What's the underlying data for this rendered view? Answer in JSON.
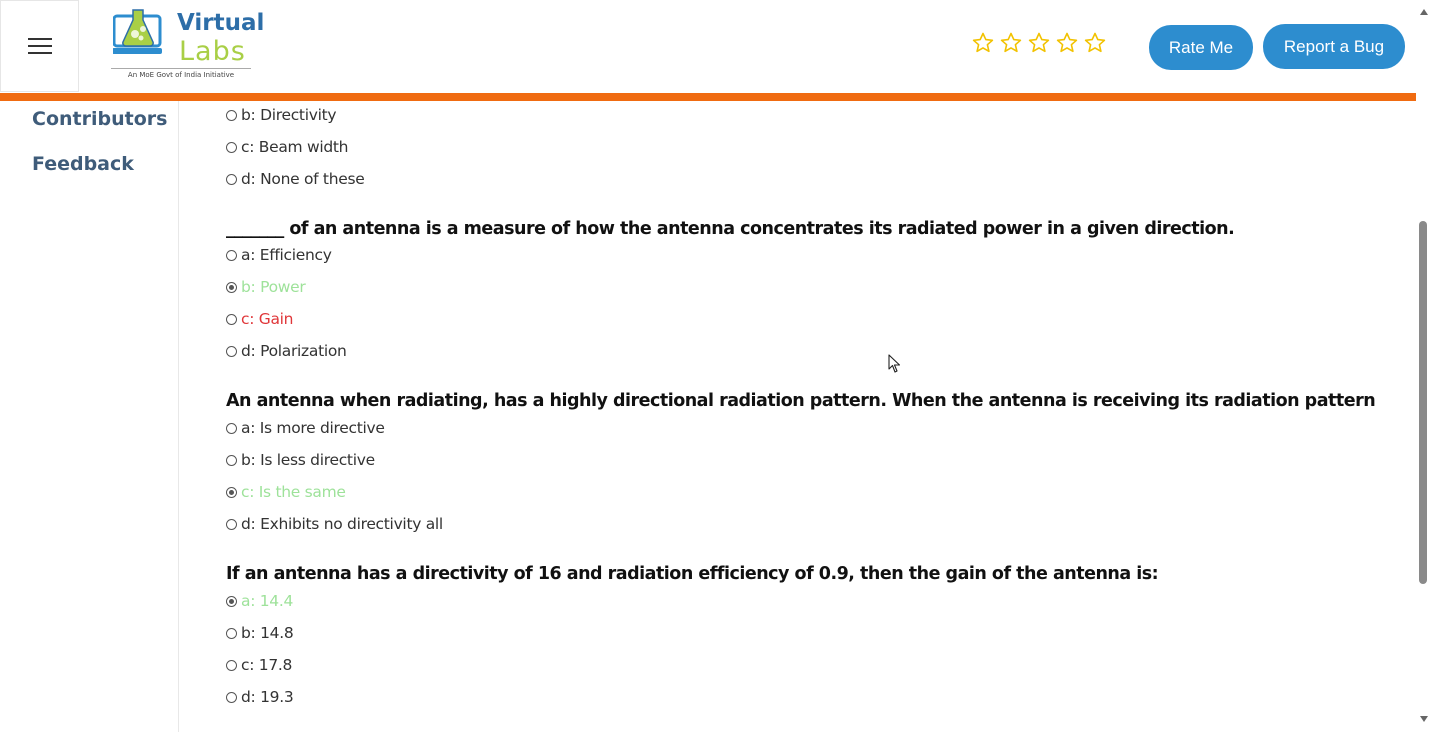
{
  "header": {
    "logo": {
      "word1": "Virtual",
      "word2": "Labs",
      "tagline": "An MoE Govt of India Initiative"
    },
    "rating": {
      "stars_total": 5,
      "stars_filled": 0
    },
    "rate_button_label": "Rate Me",
    "report_button_label": "Report a Bug"
  },
  "sidebar": {
    "items": [
      {
        "label": "Contributors"
      },
      {
        "label": "Feedback"
      }
    ]
  },
  "quiz": {
    "top_options": [
      {
        "label": "b: Directivity",
        "checked": false,
        "state": "normal"
      },
      {
        "label": "c: Beam width",
        "checked": false,
        "state": "normal"
      },
      {
        "label": "d: None of these",
        "checked": false,
        "state": "normal"
      }
    ],
    "questions": [
      {
        "text": "_______ of an antenna is a measure of how the antenna concentrates its radiated power in a given direction.",
        "options": [
          {
            "label": "a: Efficiency",
            "checked": false,
            "state": "normal"
          },
          {
            "label": "b: Power",
            "checked": true,
            "state": "correct"
          },
          {
            "label": "c: Gain",
            "checked": false,
            "state": "wrong"
          },
          {
            "label": "d: Polarization",
            "checked": false,
            "state": "normal"
          }
        ]
      },
      {
        "text": "An antenna when radiating, has a highly directional radiation pattern. When the antenna is receiving its radiation pattern",
        "options": [
          {
            "label": "a: Is more directive",
            "checked": false,
            "state": "normal"
          },
          {
            "label": "b: Is less directive",
            "checked": false,
            "state": "normal"
          },
          {
            "label": "c: Is the same",
            "checked": true,
            "state": "correct"
          },
          {
            "label": "d: Exhibits no directivity all",
            "checked": false,
            "state": "normal"
          }
        ]
      },
      {
        "text": "If an antenna has a directivity of 16 and radiation efficiency of 0.9, then the gain of the antenna is:",
        "options": [
          {
            "label": "a: 14.4",
            "checked": true,
            "state": "correct"
          },
          {
            "label": "b: 14.8",
            "checked": false,
            "state": "normal"
          },
          {
            "label": "c: 17.8",
            "checked": false,
            "state": "normal"
          },
          {
            "label": "d: 19.3",
            "checked": false,
            "state": "normal"
          }
        ]
      }
    ]
  },
  "colors": {
    "accent_bar": "#f06b11",
    "button": "#2d8dcf",
    "correct_text": "#9ee29a",
    "wrong_text": "#e0373a",
    "star_outline": "#f2c200",
    "sidebar_link": "#3f5c7a"
  },
  "icons": {
    "menu": "hamburger-icon",
    "star": "star-outline-icon",
    "cursor": "mouse-pointer-icon"
  }
}
